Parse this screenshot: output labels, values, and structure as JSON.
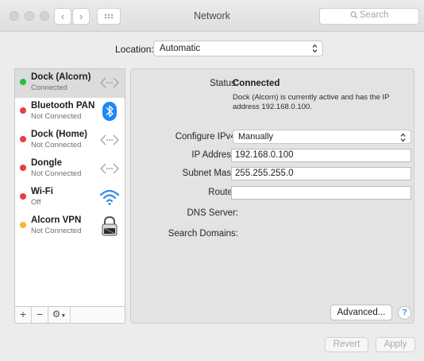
{
  "window": {
    "title": "Network"
  },
  "toolbar": {
    "back": "‹",
    "forward": "›",
    "search_placeholder": "Search"
  },
  "location": {
    "label": "Location:",
    "value": "Automatic"
  },
  "services": [
    {
      "name": "Dock (Alcorn)",
      "status": "Connected",
      "dot_color": "#2dbd3a",
      "icon": "ethernet-icon",
      "selected": true
    },
    {
      "name": "Bluetooth PAN",
      "status": "Not Connected",
      "dot_color": "#e64040",
      "icon": "bluetooth-icon",
      "selected": false
    },
    {
      "name": "Dock (Home)",
      "status": "Not Connected",
      "dot_color": "#e64040",
      "icon": "ethernet-icon",
      "selected": false
    },
    {
      "name": "Dongle",
      "status": "Not Connected",
      "dot_color": "#e64040",
      "icon": "ethernet-icon",
      "selected": false
    },
    {
      "name": "Wi-Fi",
      "status": "Off",
      "dot_color": "#e64040",
      "icon": "wifi-icon",
      "selected": false
    },
    {
      "name": "Alcorn VPN",
      "status": "Not Connected",
      "dot_color": "#f5b631",
      "icon": "vpn-lock-icon",
      "selected": false
    }
  ],
  "sidebar_footer": {
    "add": "+",
    "remove": "−",
    "gear": "⚙"
  },
  "detail": {
    "status_label": "Status:",
    "status_value": "Connected",
    "status_description": "Dock (Alcorn) is currently active and has the IP address 192.168.0.100.",
    "configure_label": "Configure IPv4:",
    "configure_value": "Manually",
    "ip_label": "IP Address:",
    "ip_value": "192.168.0.100",
    "subnet_label": "Subnet Mask:",
    "subnet_value": "255.255.255.0",
    "router_label": "Router:",
    "router_value": "",
    "dns_label": "DNS Server:",
    "search_domains_label": "Search Domains:"
  },
  "buttons": {
    "advanced": "Advanced...",
    "help": "?",
    "revert": "Revert",
    "apply": "Apply"
  },
  "colors": {
    "accent_blue": "#2f8bf0",
    "bluetooth_blue": "#1e88f5",
    "connected_green": "#2dbd3a",
    "disconnected_red": "#e64040",
    "vpn_orange": "#f5b631"
  }
}
